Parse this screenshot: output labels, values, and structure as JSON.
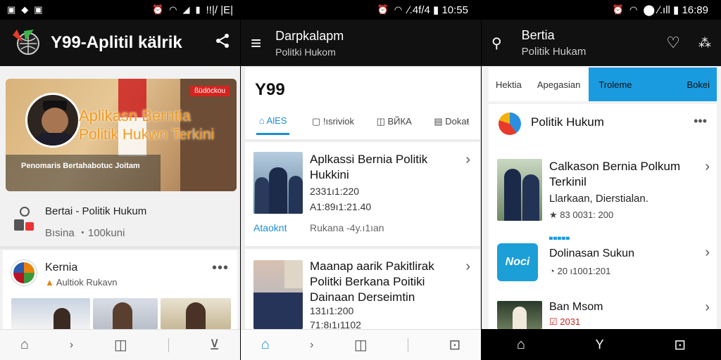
{
  "panel1": {
    "status": {
      "left_icons": [
        "app-icon",
        "app-icon",
        "image-icon"
      ],
      "right_text": "!!|/ |E|"
    },
    "appbar": {
      "title": "Y99-Aplitil kälrik"
    },
    "hero": {
      "badge": "ßüdöckou",
      "title_line1": "Aplikasn Berntia",
      "title_line2": "Politik Hukwn Terkini",
      "caption": "Penomaris Bertahabotuc Joitam"
    },
    "info": {
      "title": "Bertai - Politik Hukum",
      "subtitle": "Bısina ・100kuni"
    },
    "card": {
      "title": "Kernia",
      "subtitle": "Aultiok Rukavn"
    },
    "accent": "#e8820c"
  },
  "panel2": {
    "status": {
      "right_text": "∕.4f/4 ▮ 10:55"
    },
    "appbar": {
      "title": "Darpkalapm",
      "subtitle": "Politki Hukom"
    },
    "header_title": "Y99",
    "tabs": [
      {
        "label": "AlES"
      },
      {
        "label": "!ısriviok"
      },
      {
        "label": "ВЙКА"
      },
      {
        "label": "Dokaŧ"
      }
    ],
    "articles": [
      {
        "title": "Aplkassi Bernia Politik Hukkini",
        "date": "2331ı1:220",
        "meta": "A1:89ı1:21.40",
        "source": "Ataoknt",
        "tag": "Rukana -4y.ı1ıan"
      },
      {
        "title": "Maanap aarik Pakitlirak Politki Berkana Poitiki Dainaan Derseimtin",
        "date": "131ı1:200",
        "meta": "71:8ı1ı1102",
        "source": "",
        "tag": ""
      }
    ],
    "accent": "#1a8fd6"
  },
  "panel3": {
    "status": {
      "right_text": "⬤ ∕.ıll ▮ 16:89"
    },
    "appbar": {
      "title": "Bertia",
      "subtitle": "Politik Hukam"
    },
    "tabs": [
      {
        "label": "Hektia"
      },
      {
        "label": "Apegasian"
      },
      {
        "label": "Troleme"
      },
      {
        "label": "Bokei"
      }
    ],
    "section_title": "Politik Hukum",
    "items": [
      {
        "title": "Calkason Bernia Polkum Terkinil",
        "subtitle": "Llarkaan, Dierstialan.",
        "meta": "★ 83 0031: 200",
        "thumb_text": ""
      },
      {
        "title": "Dolinasan Sukun",
        "subtitle": "",
        "meta": "◔ 20 ı1001:201",
        "thumb_text": "Noci",
        "thumb_label": "▀▀▀▀▀"
      },
      {
        "title": "Ban Msom",
        "subtitle": "",
        "meta": "☑ 2031",
        "thumb_text": ""
      }
    ],
    "tab_active_color": "#1a9be0"
  }
}
